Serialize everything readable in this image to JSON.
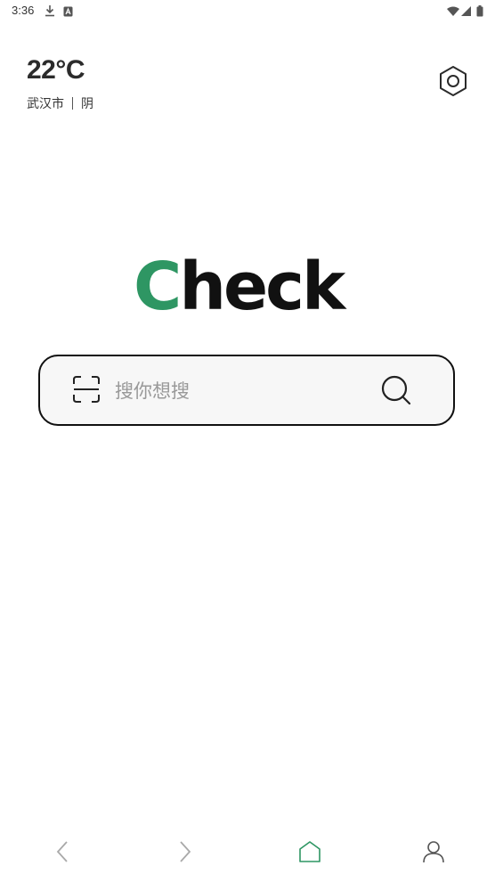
{
  "status_bar": {
    "time": "3:36",
    "icons": [
      "download-icon",
      "a-badge-icon",
      "wifi-icon",
      "cell-signal-icon",
      "battery-icon"
    ]
  },
  "weather": {
    "temperature": "22°C",
    "city": "武汉市",
    "condition": "阴"
  },
  "logo": {
    "first_letter": "C",
    "rest": "heck",
    "accent_color": "#2e9663"
  },
  "search": {
    "placeholder": "搜你想搜",
    "value": ""
  },
  "bottom_nav": {
    "items": [
      "back-icon",
      "forward-icon",
      "home-icon",
      "profile-icon"
    ],
    "active_color": "#2e9663"
  }
}
